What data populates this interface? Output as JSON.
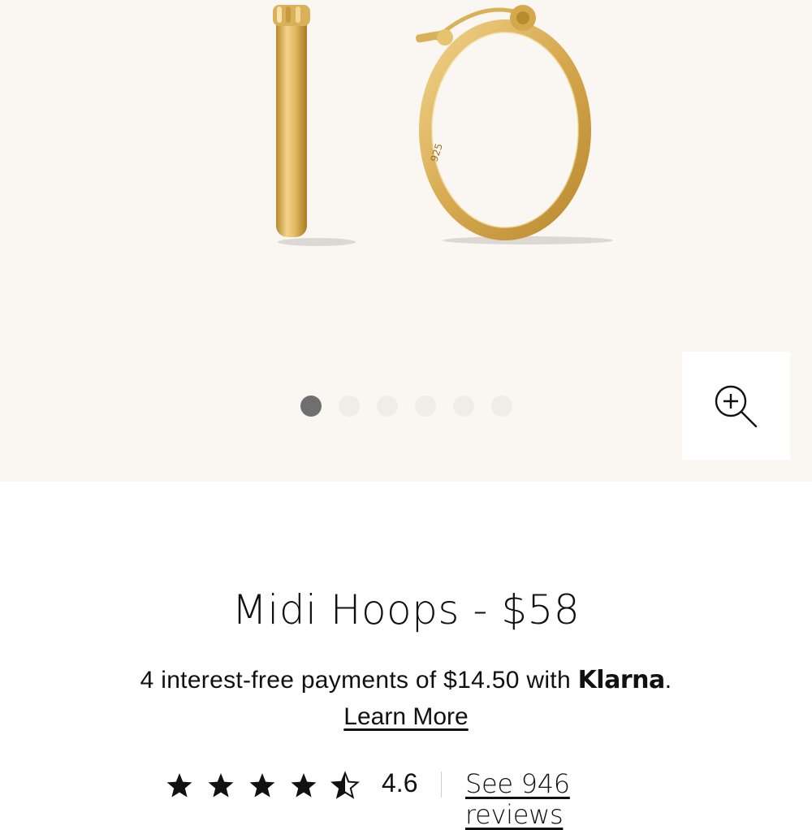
{
  "product": {
    "title": "Midi Hoops - $58",
    "image_alt": "Gold hoop earrings"
  },
  "gallery": {
    "slide_count": 6,
    "active_slide": 1,
    "zoom_icon": "zoom-in-icon"
  },
  "klarna": {
    "text": "4 interest-free payments of $14.50 with ",
    "brand": "Klarna",
    "suffix": ".",
    "learn_more": "Learn More"
  },
  "rating": {
    "value": "4.6",
    "stars": 4.5,
    "max_stars": 5,
    "reviews_link": "See 946 reviews"
  },
  "colors": {
    "gallery_bg": "#faf7f3",
    "dot_active": "#6f6f6f",
    "dot_inactive": "#f0ece7",
    "gold": "#d9b15a"
  }
}
